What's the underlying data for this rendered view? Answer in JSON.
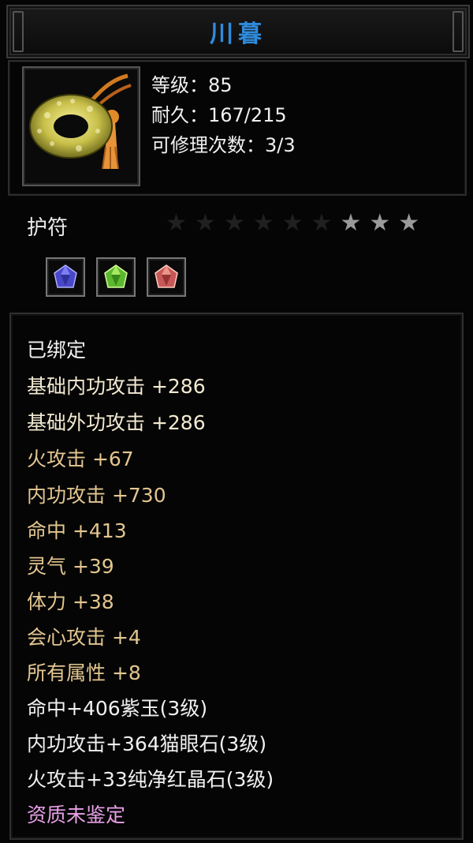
{
  "title": "川暮",
  "header": {
    "level": "等级：85",
    "durability": "耐久：167/215",
    "repairs": "可修理次数：3/3"
  },
  "item_type": "护符",
  "stars": {
    "total": 9,
    "lit": 3
  },
  "gems": [
    {
      "icon": "purple-gem-icon",
      "color": "#5a5ad8"
    },
    {
      "icon": "green-gem-icon",
      "color": "#7ad040"
    },
    {
      "icon": "red-gem-icon",
      "color": "#e0706a"
    }
  ],
  "attributes": {
    "bound": "已绑定",
    "base_inner_attack": "基础内功攻击  +286",
    "base_outer_attack": "基础外功攻击  +286",
    "fire_attack": "火攻击  +67",
    "inner_attack": "内功攻击  +730",
    "accuracy": "命中  +413",
    "spirit": "灵气  +39",
    "stamina": "体力  +38",
    "crit_attack": "会心攻击  +4",
    "all_attributes": "所有属性  +8",
    "gem_accuracy": "命中+406紫玉(3级)",
    "gem_inner_attack": "内功攻击+364猫眼石(3级)",
    "gem_fire_attack": "火攻击+33纯净红晶石(3级)",
    "quality": "资质未鉴定"
  }
}
